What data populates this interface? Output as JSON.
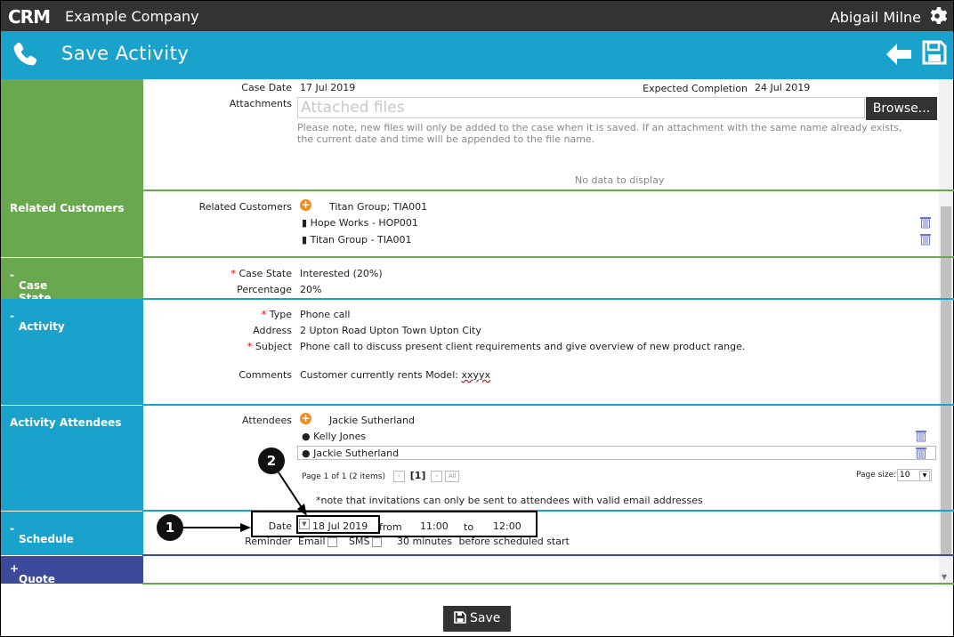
{
  "header": {
    "logo": "CRM",
    "company": "Example Company",
    "user": "Abigail Milne"
  },
  "title_bar": {
    "title": "Save Activity"
  },
  "case": {
    "case_date_label": "Case Date",
    "case_date": "17 Jul 2019",
    "expected_completion_label": "Expected Completion",
    "expected_completion": "24 Jul 2019",
    "attachments_label": "Attachments",
    "attachments_placeholder": "Attached files",
    "browse_label": "Browse...",
    "attachments_note": "Please note, new files will only be added to the case when it is saved. If an attachment with the same name already exists, the current date and time will be appended to the file name.",
    "no_data": "No data to display"
  },
  "related_customers": {
    "section_label": "Related Customers",
    "field_label": "Related Customers",
    "selected": "Titan Group; TIA001",
    "items": [
      "Hope Works - HOP001",
      "Titan Group - TIA001"
    ]
  },
  "case_state": {
    "section_label": "Case State",
    "state_label": "Case State",
    "state": "Interested (20%)",
    "percentage_label": "Percentage",
    "percentage": "20%"
  },
  "activity": {
    "section_label": "Activity",
    "type_label": "Type",
    "type": "Phone call",
    "address_label": "Address",
    "address": "2 Upton Road Upton Town Upton City",
    "subject_label": "Subject",
    "subject": "Phone call to discuss present client requirements and give overview of new product range.",
    "comments_label": "Comments",
    "comments_prefix": "Customer currently rents Model: ",
    "comments_model": "xxyyx"
  },
  "attendees": {
    "section_label": "Activity Attendees",
    "field_label": "Attendees",
    "selected": "Jackie Sutherland",
    "items": [
      "Kelly Jones",
      "Jackie Sutherland"
    ],
    "pager_text": "Page 1 of 1 (2 items)",
    "current_page": "[1]",
    "page_size_label": "Page size:",
    "page_size": "10",
    "note": "*note that invitations can only be sent to attendees with valid email addresses"
  },
  "schedule": {
    "section_label": "Schedule",
    "date_label": "Date",
    "date": "18 Jul 2019",
    "from_label": "from",
    "from_time": "11:00",
    "to_label": "to",
    "to_time": "12:00",
    "reminder_label": "Reminder",
    "email_label": "Email",
    "sms_label": "SMS",
    "minutes": "30 minutes",
    "before_label": "before scheduled start"
  },
  "quote": {
    "section_label": "Quote"
  },
  "footer": {
    "save_label": "Save"
  },
  "callouts": {
    "one": "1",
    "two": "2"
  },
  "colors": {
    "green": "#6aa84f",
    "blue": "#19a3cc",
    "navy": "#3d4a9c",
    "dark": "#333333",
    "orange": "#f08c1a"
  }
}
